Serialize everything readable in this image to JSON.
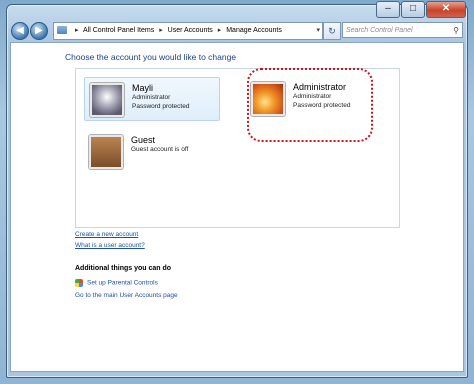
{
  "window": {
    "close_glyph": "✕",
    "minimize_glyph": "–",
    "maximize_glyph": "□"
  },
  "navigation": {
    "back_glyph": "◀",
    "forward_glyph": "▶",
    "breadcrumb": [
      "All Control Panel Items",
      "User Accounts",
      "Manage Accounts"
    ],
    "breadcrumb_separator": "▸",
    "dropdown_glyph": "▾",
    "refresh_glyph": "↻",
    "search_placeholder": "Search Control Panel",
    "search_icon": "⚲"
  },
  "main": {
    "heading": "Choose the account you would like to change",
    "accounts": [
      {
        "name": "Mayli",
        "lines": [
          "Administrator",
          "Password protected"
        ],
        "picture": "mayli-user-picture"
      },
      {
        "name": "Administrator",
        "lines": [
          "Administrator",
          "Password protected"
        ],
        "picture": "orange-flower-picture"
      },
      {
        "name": "Guest",
        "lines": [
          "Guest account is off"
        ],
        "picture": "guest-suitcase-picture"
      }
    ],
    "links": {
      "create": "Create a new account",
      "what_is": "What is a user account?"
    },
    "additional": {
      "title": "Additional things you can do",
      "parental": "Set up Parental Controls",
      "main_page": "Go to the main User Accounts page"
    }
  },
  "colors": {
    "heading": "#1e3f8a",
    "link": "#1f4fae",
    "highlight_ring": "#d0121a"
  }
}
